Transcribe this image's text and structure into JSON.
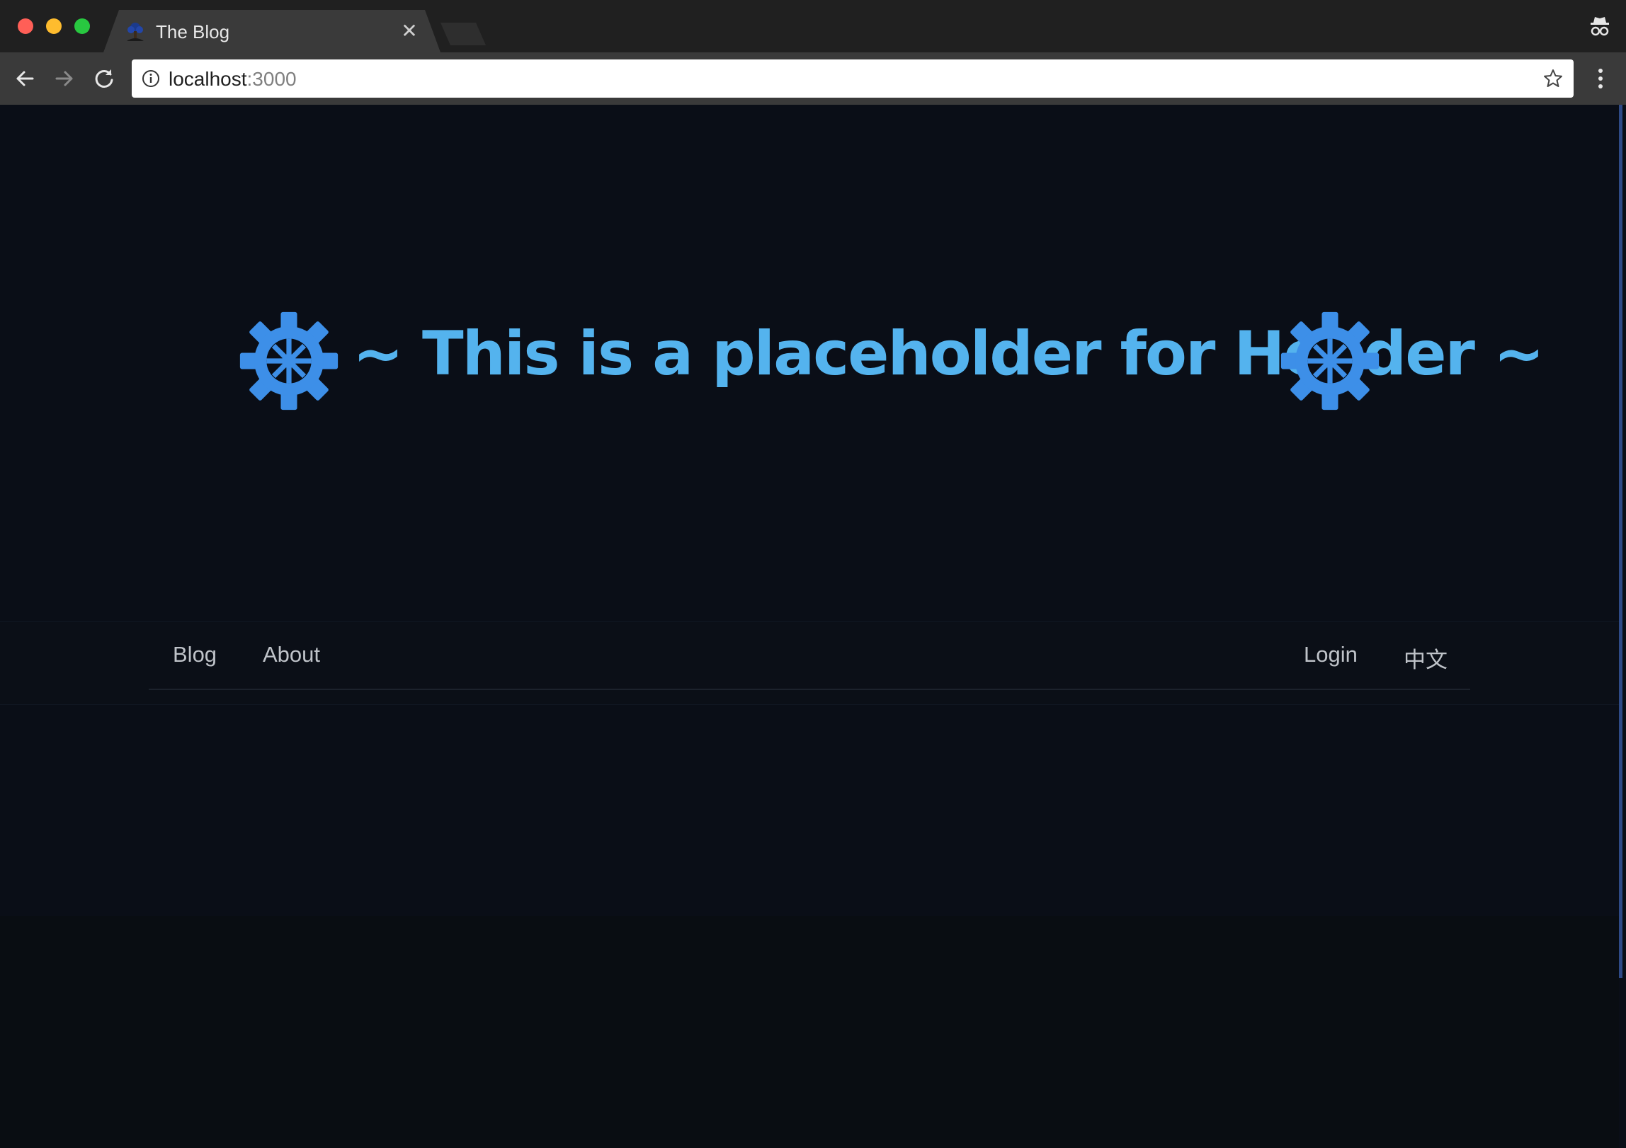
{
  "browser": {
    "tab": {
      "title": "The Blog",
      "close_glyph": "✕"
    },
    "address_bar": {
      "host": "localhost",
      "port": ":3000"
    },
    "icons": {
      "favicon": "tree-favicon-icon",
      "incognito": "incognito-icon",
      "back": "arrow-left-icon",
      "forward": "arrow-right-icon",
      "reload": "reload-icon",
      "info": "info-icon",
      "bookmark": "star-icon",
      "menu": "kebab-menu-icon"
    },
    "colors": {
      "traffic_close": "#ff5f57",
      "traffic_min": "#febc2e",
      "traffic_max": "#28c840"
    }
  },
  "page": {
    "header": {
      "title": "~ This is a placeholder for Header ~",
      "icon": "gear-icon",
      "color": "#54b3ee",
      "gear_color": "#3d8fe8"
    },
    "nav": {
      "left": [
        {
          "label": "Blog"
        },
        {
          "label": "About"
        }
      ],
      "right": [
        {
          "label": "Login"
        },
        {
          "label": "中文"
        }
      ]
    }
  }
}
